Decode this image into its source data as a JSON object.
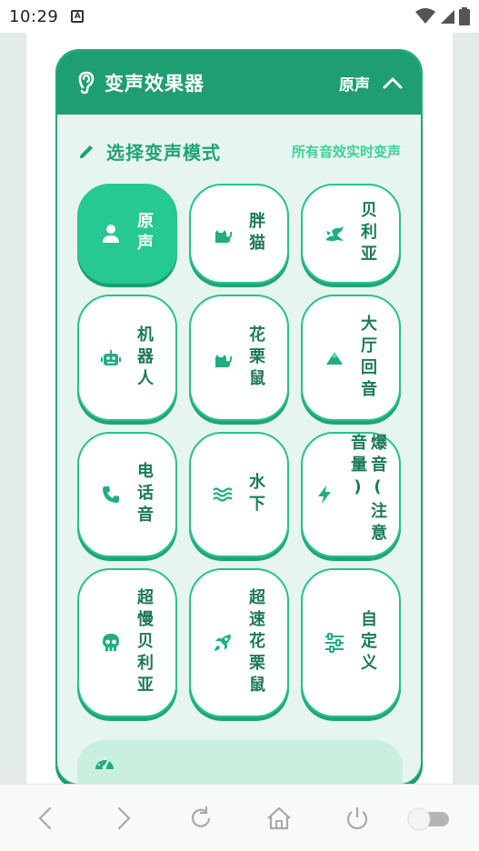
{
  "status_bar": {
    "time": "10:29",
    "notif_letter": "A"
  },
  "header": {
    "title": "变声效果器",
    "current_mode": "原声"
  },
  "section": {
    "title": "选择变声模式",
    "hint": "所有音效实时变声"
  },
  "modes": [
    {
      "label": "原声",
      "icon": "person-icon",
      "active": true
    },
    {
      "label": "胖猫",
      "icon": "cat-icon"
    },
    {
      "label": "贝利亚",
      "icon": "dragon-icon"
    },
    {
      "label": "机器人",
      "icon": "robot-icon"
    },
    {
      "label": "花栗鼠",
      "icon": "cat-icon"
    },
    {
      "label": "大厅回音",
      "icon": "mountain-icon"
    },
    {
      "label": "电话音",
      "icon": "phone-icon"
    },
    {
      "label": "水下",
      "icon": "water-icon"
    },
    {
      "label": "爆音(注意音量)",
      "icon": "bolt-icon"
    },
    {
      "label": "超慢贝利亚",
      "icon": "skull-icon"
    },
    {
      "label": "超速花栗鼠",
      "icon": "rocket-icon"
    },
    {
      "label": "自定义",
      "icon": "sliders-icon"
    }
  ],
  "colors": {
    "primary": "#1f9e72",
    "accent": "#26c991",
    "text": "#1d7a57",
    "hint": "#3fcf97",
    "panel": "#e6f5ef"
  }
}
